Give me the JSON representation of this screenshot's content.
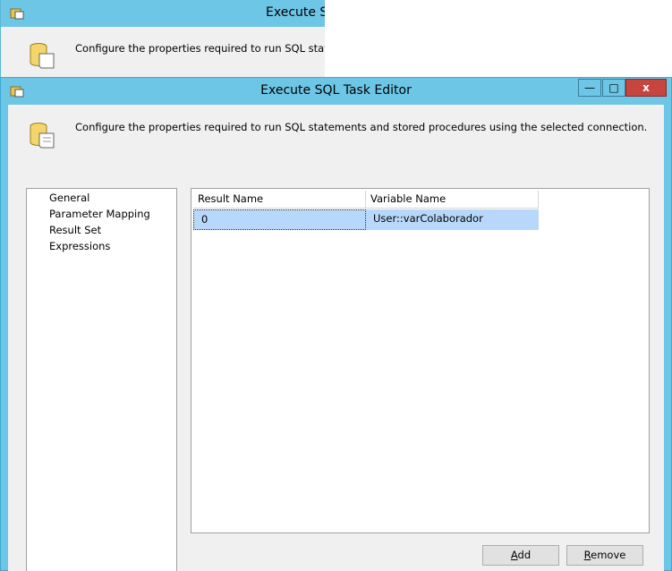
{
  "background_window": {
    "title": "Execute SC",
    "description": "Configure the properties required to run SQL stateme"
  },
  "window": {
    "title": "Execute SQL Task Editor",
    "controls": {
      "minimize": "—",
      "maximize": "□",
      "close": "x"
    }
  },
  "header": {
    "description": "Configure the properties required to run SQL statements and stored procedures using the selected connection."
  },
  "nav": {
    "items": [
      {
        "label": "General"
      },
      {
        "label": "Parameter Mapping"
      },
      {
        "label": "Result Set"
      },
      {
        "label": "Expressions"
      }
    ]
  },
  "result_grid": {
    "columns": [
      "Result Name",
      "Variable Name"
    ],
    "rows": [
      {
        "result_name": "0",
        "variable_name": "User::varColaborador"
      }
    ]
  },
  "buttons": {
    "add": {
      "mnemonic": "A",
      "rest": "dd"
    },
    "remove": {
      "mnemonic": "R",
      "rest": "emove"
    }
  },
  "colors": {
    "titlebar": "#6dc6e6",
    "close_button": "#c7453f",
    "selection": "#b7d8fb"
  }
}
